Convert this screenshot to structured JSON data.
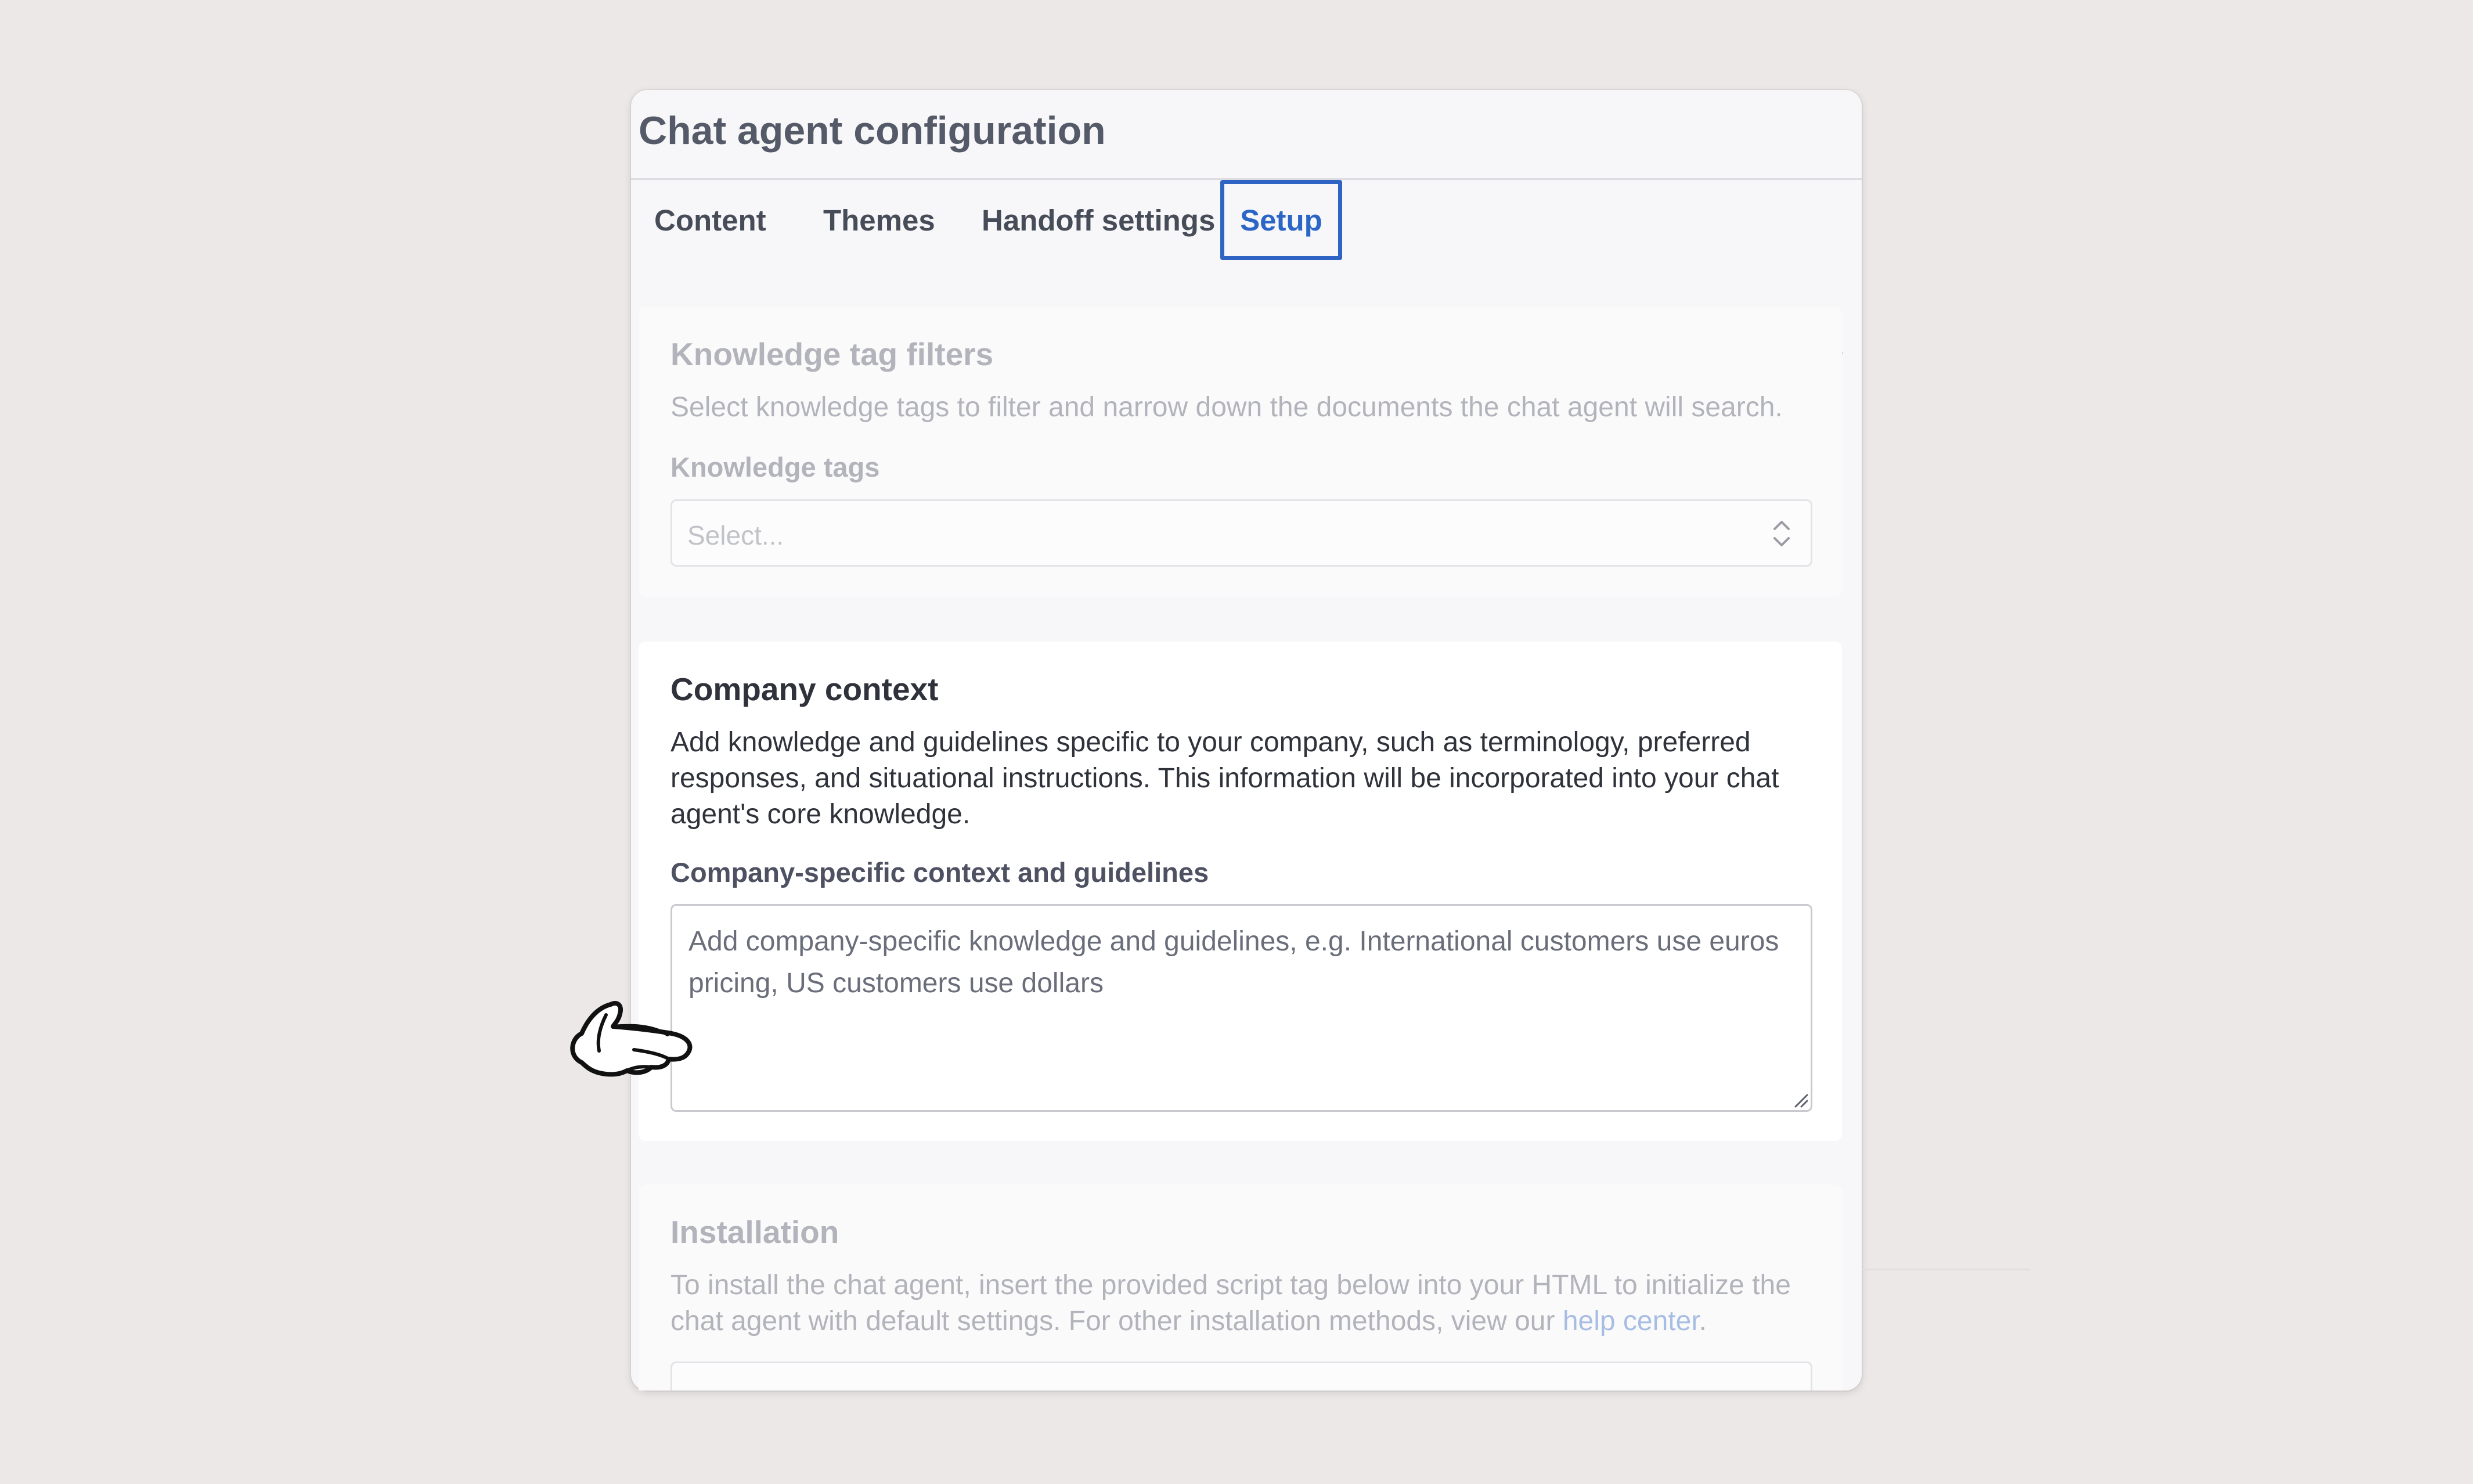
{
  "app": {
    "title": "Chat agent configuration"
  },
  "tabs": [
    {
      "label": "Content",
      "active": false
    },
    {
      "label": "Themes",
      "active": false
    },
    {
      "label": "Handoff settings",
      "active": false
    },
    {
      "label": "Setup",
      "active": true
    }
  ],
  "knowledge_tags": {
    "heading": "Knowledge tag filters",
    "description": "Select knowledge tags to filter and narrow down the documents the chat agent will search.",
    "field_label": "Knowledge tags",
    "select_placeholder": "Select..."
  },
  "company_context": {
    "heading": "Company context",
    "description": "Add knowledge and guidelines specific to your company, such as terminology, preferred responses, and situational instructions. This information will be incorporated into your chat agent's core knowledge.",
    "field_label": "Company-specific context and guidelines",
    "textarea_placeholder": "Add company-specific knowledge and guidelines, e.g. International customers use euros pricing, US customers use dollars"
  },
  "installation": {
    "heading": "Installation",
    "description_prefix": "To install the chat agent, insert the provided script tag below into your HTML to initialize the chat agent with default settings. For other installation methods, view our ",
    "link_text": "help center",
    "description_suffix": "."
  },
  "colors": {
    "accent": "#2f63c4",
    "background": "#ece8e7",
    "link": "#a8bde3"
  },
  "icons": {
    "select_chevrons": "chevron-up-down-icon",
    "pointer": "pointing-hand-icon",
    "resize": "resize-grip-icon"
  }
}
